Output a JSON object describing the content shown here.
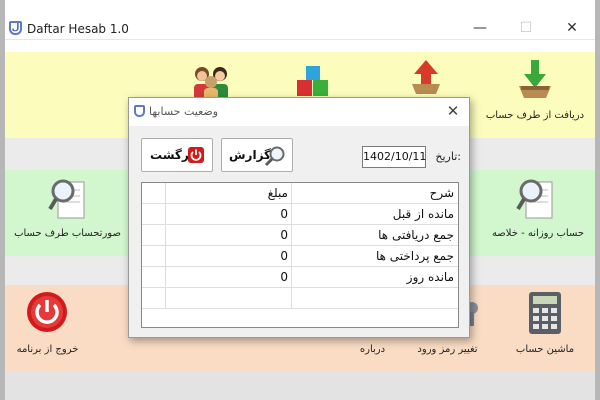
{
  "window": {
    "title": "Daftar Hesab 1.0",
    "min_glyph": "—",
    "max_glyph": "☐",
    "close_glyph": "✕"
  },
  "tiles": {
    "receive_from_party": "دریافت از طرف حساب",
    "party_statement": "صورتحساب طرف حساب",
    "daily_summary": "حساب روزانه - خلاصه",
    "exit_program": "خروج از برنامه",
    "about": "درباره",
    "change_password": "تغییر رمز ورود",
    "calculator": "ماشین حساب"
  },
  "dialog": {
    "title": "وضعیت حسابها",
    "close_glyph": "✕",
    "back_label": "برگشت",
    "report_label": "گزارش",
    "date_label": "تاریخ:",
    "date_value": "1402/10/11",
    "header": {
      "description": "شرح",
      "amount": "مبلغ"
    },
    "rows": [
      {
        "description": "مانده از قبل",
        "amount": "0"
      },
      {
        "description": "جمع دریافتی ها",
        "amount": "0"
      },
      {
        "description": "جمع پرداختی ها",
        "amount": "0"
      },
      {
        "description": "مانده روز",
        "amount": "0"
      }
    ]
  },
  "colors": {
    "yellow_band": "#fcfcbc",
    "green_band": "#d2f7ce",
    "orange_band": "#f9dcc3",
    "dialog_bg": "#f0f0f0"
  }
}
